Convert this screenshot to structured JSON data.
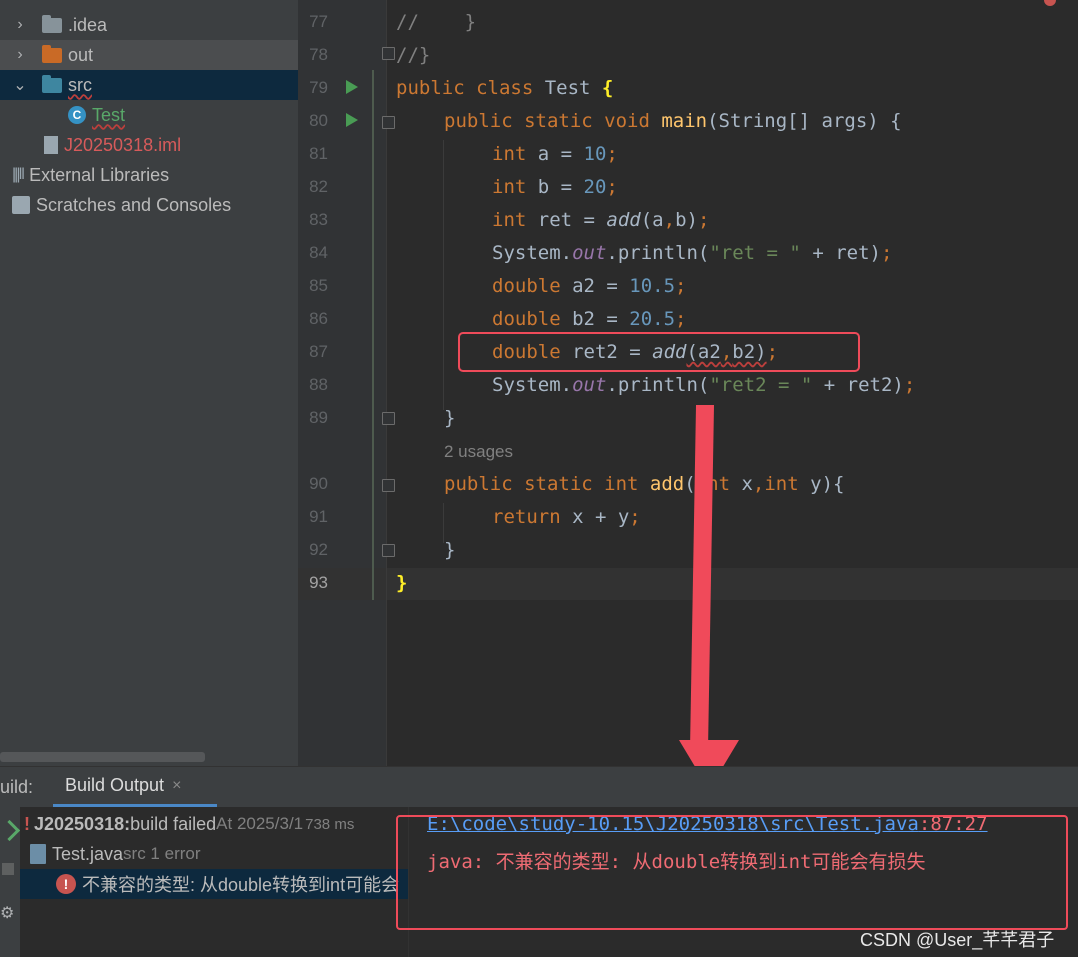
{
  "project_tree": [
    {
      "label": ".idea",
      "icon": "folder-icon",
      "expanded": false
    },
    {
      "label": "out",
      "icon": "folder-orange-icon",
      "expanded": false
    },
    {
      "label": "src",
      "icon": "folder-source-icon",
      "expanded": true
    },
    {
      "label": "Test",
      "icon": "java-class-icon"
    },
    {
      "label": "J20250318.iml",
      "icon": "module-file-icon"
    },
    {
      "label": "External Libraries",
      "icon": "libraries-icon"
    },
    {
      "label": "Scratches and Consoles",
      "icon": "scratches-icon"
    }
  ],
  "editor": {
    "line_numbers": [
      "77",
      "78",
      "79",
      "80",
      "81",
      "82",
      "83",
      "84",
      "85",
      "86",
      "87",
      "88",
      "89",
      "90",
      "91",
      "92",
      "93"
    ],
    "current_line": "93",
    "usage_hint": "2 usages",
    "code": {
      "l77": "//    }",
      "l78": "//}",
      "l79_kw": "public class ",
      "l79_name": "Test ",
      "l79_brace": "{",
      "l80_kw": "public static void ",
      "l80_fn": "main",
      "l80_rest": "(String[] args) {",
      "l81_kw": "int ",
      "l81_mid": "a = ",
      "l81_num": "10",
      "l81_semi": ";",
      "l82_kw": "int ",
      "l82_mid": "b = ",
      "l82_num": "20",
      "l82_semi": ";",
      "l83_kw": "int ",
      "l83_mid": "ret = ",
      "l83_call": "add",
      "l83_rest": "(a",
      "l83_comma": ",",
      "l83_end": "b)",
      "l83_semi": ";",
      "l84_a": "System.",
      "l84_out": "out",
      "l84_b": ".println(",
      "l84_str": "\"ret = \"",
      "l84_c": " + ret)",
      "l84_semi": ";",
      "l85_kw": "double ",
      "l85_mid": "a2 = ",
      "l85_num": "10.5",
      "l85_semi": ";",
      "l86_kw": "double ",
      "l86_mid": "b2 = ",
      "l86_num": "20.5",
      "l86_semi": ";",
      "l87_kw": "double ",
      "l87_mid": "ret2 = ",
      "l87_call": "add",
      "l87_rest": "(a2",
      "l87_comma": ",",
      "l87_end": "b2)",
      "l87_semi": ";",
      "l88_a": "System.",
      "l88_out": "out",
      "l88_b": ".println(",
      "l88_str": "\"ret2 = \"",
      "l88_c": " + ret2)",
      "l88_semi": ";",
      "l89": "}",
      "l90_kw": "public static int ",
      "l90_fn": "add",
      "l90_p1": "(",
      "l90_int1": "int ",
      "l90_x": "x",
      "l90_comma": ",",
      "l90_int2": "int ",
      "l90_rest": "y){",
      "l91_kw": "return ",
      "l91_mid": "x + y",
      "l91_semi": ";",
      "l92": "}",
      "l93": "}"
    }
  },
  "build": {
    "panel_label": "uild:",
    "tab_label": "Build Output",
    "tab_close": "×",
    "root_name": "J20250318:",
    "root_status": " build failed",
    "root_time": " At 2025/3/1",
    "root_duration": "738 ms",
    "file_name": "Test.java",
    "file_detail": " src 1 error",
    "error_item": "不兼容的类型: 从double转换到int可能会",
    "output_path": "E:\\code\\study-10.15\\J20250318\\src\\Test.java",
    "output_loc": ":87:27",
    "output_error": "java: 不兼容的类型: 从double转换到int可能会有损失"
  },
  "watermark": "CSDN @User_芊芊君子",
  "colors": {
    "annotation": "#ef4b5a",
    "keyword": "#cc7832",
    "number": "#6897bb",
    "string": "#6a8759",
    "method": "#ffc66d"
  }
}
